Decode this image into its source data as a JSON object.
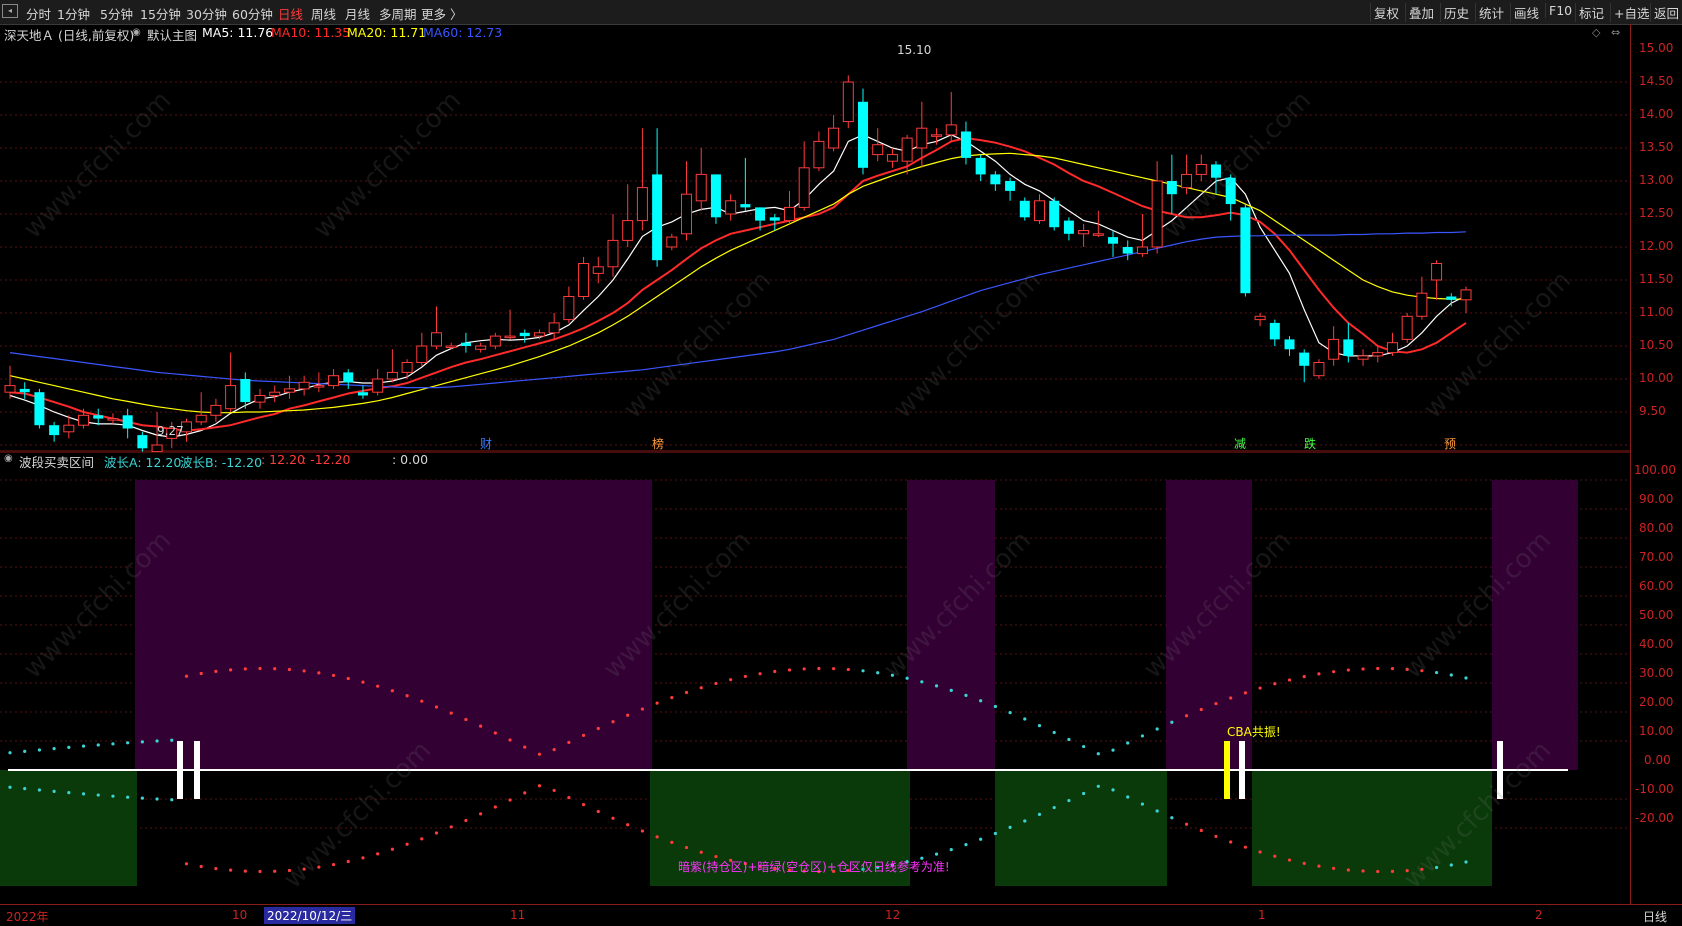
{
  "toolbar": {
    "periods": [
      "分时",
      "1分钟",
      "5分钟",
      "15分钟",
      "30分钟",
      "60分钟",
      "日线",
      "周线",
      "月线",
      "多周期",
      "更多 〉"
    ],
    "active_period": "日线",
    "right_buttons": [
      "复权",
      "叠加",
      "历史",
      "统计",
      "画线",
      "F10",
      "标记",
      "+自选",
      "返回"
    ]
  },
  "main": {
    "title": "深天地Ａ (日线,前复权)",
    "template": "默认主图",
    "ma": [
      {
        "label": "MA5: 11.76",
        "color": "#ffffff"
      },
      {
        "label": "MA10: 11.35",
        "color": "#ff2a2a"
      },
      {
        "label": "MA20: 11.71",
        "color": "#ffff00"
      },
      {
        "label": "MA60: 12.73",
        "color": "#3a56ff"
      }
    ],
    "high_label": "15.10",
    "low_label": "9.27",
    "events": [
      {
        "text": "财",
        "color": "#3a7bff"
      },
      {
        "text": "榜",
        "color": "#ff9a3a"
      },
      {
        "text": "减",
        "color": "#46ff46"
      },
      {
        "text": "跌",
        "color": "#46ff46"
      },
      {
        "text": "预",
        "color": "#ff9a3a"
      }
    ],
    "y_ticks": [
      "15.00",
      "14.50",
      "14.00",
      "13.50",
      "13.00",
      "12.50",
      "12.00",
      "11.50",
      "11.00",
      "10.50",
      "10.00",
      "9.50"
    ]
  },
  "indicator": {
    "title": "波段买卖区间",
    "legend": [
      {
        "label": "波长A: 12.20",
        "color": "#3ad4d4"
      },
      {
        "label": "波长B: -12.20",
        "color": "#3ad4d4"
      },
      {
        "label": ": 12.20",
        "color": "#ff3b3b"
      },
      {
        "label": ": -12.20",
        "color": "#ff3b3b"
      },
      {
        "label": ": 0.00",
        "color": "#d6d6d6"
      }
    ],
    "cba_label": "CBA共振!",
    "note": "暗紫(持仓区)+暗绿(空仓区)+仓区仅日线参考为准!",
    "y_ticks": [
      "100.00",
      "90.00",
      "80.00",
      "70.00",
      "60.00",
      "50.00",
      "40.00",
      "30.00",
      "20.00",
      "10.00",
      "0.00",
      "-10.00",
      "-20.00"
    ]
  },
  "bottom": {
    "dates": [
      "2022年",
      "10",
      "2022/10/12/三",
      "11",
      "12",
      "1",
      "2"
    ],
    "period_label": "日线"
  },
  "watermark": "www.cfchi.com",
  "chart_data": {
    "type": "candlestick",
    "title": "深天地Ａ (日线,前复权)",
    "ylim": [
      9.0,
      15.3
    ],
    "candles": [
      [
        10.3,
        10.4,
        10.7,
        10.2
      ],
      [
        10.35,
        10.3,
        10.45,
        10.2
      ],
      [
        10.3,
        9.8,
        10.35,
        9.75
      ],
      [
        9.8,
        9.65,
        9.85,
        9.55
      ],
      [
        9.7,
        9.8,
        9.95,
        9.6
      ],
      [
        9.8,
        9.95,
        10.05,
        9.75
      ],
      [
        9.95,
        9.9,
        10.05,
        9.8
      ],
      [
        9.9,
        9.9,
        9.98,
        9.82
      ],
      [
        9.95,
        9.75,
        10.05,
        9.6
      ],
      [
        9.65,
        9.45,
        9.7,
        9.4
      ],
      [
        9.4,
        9.5,
        10.0,
        9.27
      ],
      [
        9.6,
        9.75,
        9.85,
        9.45
      ],
      [
        9.7,
        9.85,
        9.9,
        9.55
      ],
      [
        9.85,
        9.95,
        10.3,
        9.8
      ],
      [
        9.95,
        10.1,
        10.2,
        9.85
      ],
      [
        10.05,
        10.4,
        10.9,
        10.0
      ],
      [
        10.5,
        10.15,
        10.6,
        10.05
      ],
      [
        10.15,
        10.25,
        10.35,
        10.05
      ],
      [
        10.25,
        10.3,
        10.4,
        10.15
      ],
      [
        10.3,
        10.35,
        10.55,
        10.2
      ],
      [
        10.35,
        10.45,
        10.55,
        10.25
      ],
      [
        10.4,
        10.4,
        10.6,
        10.3
      ],
      [
        10.4,
        10.55,
        10.65,
        10.35
      ],
      [
        10.6,
        10.45,
        10.65,
        10.35
      ],
      [
        10.3,
        10.25,
        10.4,
        10.2
      ],
      [
        10.3,
        10.5,
        10.65,
        10.25
      ],
      [
        10.5,
        10.6,
        10.95,
        10.45
      ],
      [
        10.6,
        10.75,
        10.8,
        10.5
      ],
      [
        10.75,
        11.0,
        11.2,
        10.7
      ],
      [
        11.0,
        11.2,
        11.6,
        10.95
      ],
      [
        11.0,
        11.0,
        11.05,
        10.95
      ],
      [
        11.05,
        11.0,
        11.2,
        10.9
      ],
      [
        10.95,
        11.0,
        11.05,
        10.9
      ],
      [
        11.0,
        11.15,
        11.2,
        10.95
      ],
      [
        11.15,
        11.15,
        11.55,
        11.1
      ],
      [
        11.2,
        11.15,
        11.25,
        11.05
      ],
      [
        11.15,
        11.2,
        11.25,
        11.1
      ],
      [
        11.2,
        11.35,
        11.5,
        11.1
      ],
      [
        11.4,
        11.75,
        11.9,
        11.35
      ],
      [
        11.75,
        12.25,
        12.35,
        11.7
      ],
      [
        12.1,
        12.2,
        12.35,
        11.95
      ],
      [
        12.2,
        12.6,
        13.0,
        12.05
      ],
      [
        12.6,
        12.9,
        13.45,
        12.5
      ],
      [
        12.9,
        13.4,
        14.3,
        12.75
      ],
      [
        13.6,
        12.3,
        14.3,
        12.2
      ],
      [
        12.5,
        12.65,
        12.7,
        12.45
      ],
      [
        12.7,
        13.3,
        13.8,
        12.6
      ],
      [
        13.2,
        13.6,
        14.0,
        13.05
      ],
      [
        13.6,
        12.95,
        13.6,
        12.85
      ],
      [
        13.0,
        13.2,
        13.3,
        12.9
      ],
      [
        13.15,
        13.1,
        13.85,
        13.05
      ],
      [
        13.1,
        12.9,
        13.1,
        12.75
      ],
      [
        12.95,
        12.9,
        13.0,
        12.75
      ],
      [
        12.9,
        13.1,
        13.35,
        12.85
      ],
      [
        13.1,
        13.7,
        14.1,
        13.05
      ],
      [
        13.7,
        14.1,
        14.25,
        13.65
      ],
      [
        14.0,
        14.3,
        14.5,
        13.95
      ],
      [
        14.4,
        15.0,
        15.1,
        14.3
      ],
      [
        14.7,
        13.7,
        14.9,
        13.6
      ],
      [
        13.9,
        14.05,
        14.3,
        13.8
      ],
      [
        13.8,
        13.9,
        14.0,
        13.7
      ],
      [
        13.8,
        14.15,
        14.2,
        13.6
      ],
      [
        14.0,
        14.3,
        14.7,
        13.7
      ],
      [
        14.2,
        14.2,
        14.3,
        14.05
      ],
      [
        14.2,
        14.35,
        14.85,
        14.1
      ],
      [
        14.25,
        13.85,
        14.4,
        13.75
      ],
      [
        13.85,
        13.6,
        13.9,
        13.5
      ],
      [
        13.6,
        13.45,
        13.65,
        13.35
      ],
      [
        13.5,
        13.35,
        13.55,
        13.2
      ],
      [
        13.2,
        12.95,
        13.25,
        12.9
      ],
      [
        12.9,
        13.2,
        13.3,
        12.85
      ],
      [
        13.2,
        12.8,
        13.25,
        12.75
      ],
      [
        12.9,
        12.7,
        12.95,
        12.6
      ],
      [
        12.7,
        12.75,
        12.85,
        12.5
      ],
      [
        12.7,
        12.7,
        13.05,
        12.65
      ],
      [
        12.65,
        12.55,
        12.75,
        12.35
      ],
      [
        12.5,
        12.4,
        12.6,
        12.3
      ],
      [
        12.4,
        12.5,
        13.0,
        12.35
      ],
      [
        12.5,
        13.5,
        13.8,
        12.4
      ],
      [
        13.5,
        13.3,
        13.9,
        13.0
      ],
      [
        13.4,
        13.6,
        13.9,
        13.3
      ],
      [
        13.6,
        13.75,
        13.9,
        13.5
      ],
      [
        13.75,
        13.55,
        13.8,
        13.3
      ],
      [
        13.55,
        13.15,
        13.6,
        12.9
      ],
      [
        13.1,
        11.8,
        13.15,
        11.75
      ],
      [
        11.4,
        11.45,
        11.5,
        11.3
      ],
      [
        11.35,
        11.1,
        11.4,
        11.0
      ],
      [
        11.1,
        10.95,
        11.15,
        10.85
      ],
      [
        10.9,
        10.7,
        10.95,
        10.45
      ],
      [
        10.55,
        10.75,
        10.8,
        10.5
      ],
      [
        10.8,
        11.1,
        11.3,
        10.7
      ],
      [
        11.1,
        10.85,
        11.35,
        10.75
      ],
      [
        10.8,
        10.85,
        10.95,
        10.7
      ],
      [
        10.85,
        10.9,
        11.0,
        10.75
      ],
      [
        10.9,
        11.05,
        11.2,
        10.85
      ],
      [
        11.1,
        11.45,
        11.5,
        11.05
      ],
      [
        11.45,
        11.8,
        12.05,
        11.4
      ],
      [
        12.0,
        12.25,
        12.3,
        11.7
      ],
      [
        11.75,
        11.7,
        11.8,
        11.6
      ],
      [
        11.7,
        11.85,
        11.9,
        11.5
      ]
    ],
    "series": [
      {
        "name": "MA5",
        "color": "#ffffff",
        "values": [
          10.25,
          10.18,
          10.1,
          10.0,
          9.92,
          9.85,
          9.82,
          9.82,
          9.8,
          9.72,
          9.65,
          9.62,
          9.66,
          9.72,
          9.82,
          9.98,
          10.1,
          10.2,
          10.23,
          10.3,
          10.35,
          10.42,
          10.45,
          10.46,
          10.44,
          10.44,
          10.47,
          10.53,
          10.68,
          10.86,
          10.96,
          11.05,
          11.08,
          11.1,
          11.09,
          11.1,
          11.13,
          11.2,
          11.32,
          11.54,
          11.75,
          12.0,
          12.32,
          12.66,
          12.8,
          12.88,
          13.0,
          13.07,
          13.1,
          13.0,
          13.04,
          13.08,
          13.1,
          13.05,
          13.22,
          13.45,
          13.65,
          14.1,
          14.2,
          14.1,
          14.0,
          13.95,
          14.05,
          14.1,
          14.2,
          14.1,
          13.95,
          13.8,
          13.6,
          13.45,
          13.35,
          13.2,
          13.05,
          12.9,
          12.85,
          12.75,
          12.65,
          12.6,
          12.75,
          12.9,
          13.1,
          13.3,
          13.5,
          13.55,
          13.3,
          12.8,
          12.45,
          12.1,
          11.55,
          11.05,
          10.9,
          10.85,
          10.85,
          10.85,
          10.9,
          11.0,
          11.2,
          11.45,
          11.65,
          11.76
        ]
      },
      {
        "name": "MA10",
        "color": "#ff2a2a",
        "values": [
          10.3,
          10.28,
          10.22,
          10.15,
          10.08,
          10.0,
          9.95,
          9.9,
          9.85,
          9.8,
          9.78,
          9.74,
          9.72,
          9.74,
          9.77,
          9.8,
          9.86,
          9.92,
          9.97,
          10.05,
          10.1,
          10.16,
          10.22,
          10.28,
          10.32,
          10.36,
          10.39,
          10.44,
          10.52,
          10.6,
          10.68,
          10.75,
          10.8,
          10.86,
          10.92,
          10.98,
          11.04,
          11.1,
          11.18,
          11.27,
          11.38,
          11.5,
          11.65,
          11.85,
          12.0,
          12.15,
          12.32,
          12.48,
          12.6,
          12.7,
          12.75,
          12.8,
          12.85,
          12.9,
          12.95,
          13.0,
          13.1,
          13.3,
          13.5,
          13.58,
          13.65,
          13.72,
          13.85,
          13.97,
          14.1,
          14.15,
          14.12,
          14.08,
          14.02,
          13.95,
          13.85,
          13.75,
          13.62,
          13.5,
          13.42,
          13.32,
          13.22,
          13.12,
          13.05,
          13.0,
          12.95,
          12.95,
          12.98,
          13.02,
          12.98,
          12.88,
          12.7,
          12.45,
          12.15,
          11.85,
          11.58,
          11.35,
          11.18,
          11.0,
          10.92,
          10.9,
          10.95,
          11.05,
          11.2,
          11.35
        ]
      },
      {
        "name": "MA20",
        "color": "#ffff00",
        "values": [
          10.55,
          10.5,
          10.45,
          10.4,
          10.35,
          10.3,
          10.25,
          10.2,
          10.16,
          10.12,
          10.08,
          10.05,
          10.02,
          10.0,
          9.99,
          9.99,
          10.0,
          10.0,
          10.01,
          10.02,
          10.03,
          10.05,
          10.07,
          10.1,
          10.13,
          10.17,
          10.22,
          10.28,
          10.34,
          10.4,
          10.46,
          10.52,
          10.58,
          10.64,
          10.7,
          10.77,
          10.84,
          10.92,
          11.0,
          11.1,
          11.2,
          11.32,
          11.45,
          11.6,
          11.75,
          11.9,
          12.05,
          12.2,
          12.33,
          12.45,
          12.55,
          12.65,
          12.75,
          12.85,
          12.95,
          13.05,
          13.15,
          13.3,
          13.42,
          13.5,
          13.58,
          13.65,
          13.72,
          13.78,
          13.84,
          13.88,
          13.9,
          13.91,
          13.92,
          13.9,
          13.88,
          13.85,
          13.8,
          13.75,
          13.7,
          13.65,
          13.6,
          13.55,
          13.5,
          13.45,
          13.4,
          13.35,
          13.3,
          13.25,
          13.15,
          13.05,
          12.9,
          12.75,
          12.6,
          12.45,
          12.3,
          12.15,
          12.0,
          11.9,
          11.82,
          11.77,
          11.74,
          11.72,
          11.71,
          11.71
        ]
      },
      {
        "name": "MA60",
        "color": "#3a56ff",
        "values": [
          10.9,
          10.87,
          10.84,
          10.81,
          10.78,
          10.75,
          10.72,
          10.69,
          10.66,
          10.63,
          10.6,
          10.58,
          10.56,
          10.54,
          10.52,
          10.5,
          10.48,
          10.47,
          10.46,
          10.45,
          10.44,
          10.43,
          10.42,
          10.41,
          10.4,
          10.39,
          10.38,
          10.37,
          10.37,
          10.37,
          10.38,
          10.4,
          10.42,
          10.44,
          10.46,
          10.48,
          10.5,
          10.52,
          10.54,
          10.56,
          10.58,
          10.6,
          10.62,
          10.64,
          10.67,
          10.7,
          10.73,
          10.76,
          10.79,
          10.82,
          10.85,
          10.88,
          10.91,
          10.95,
          11.0,
          11.05,
          11.1,
          11.17,
          11.24,
          11.31,
          11.38,
          11.45,
          11.52,
          11.6,
          11.68,
          11.76,
          11.84,
          11.9,
          11.96,
          12.02,
          12.08,
          12.13,
          12.18,
          12.23,
          12.28,
          12.33,
          12.38,
          12.43,
          12.48,
          12.53,
          12.58,
          12.62,
          12.65,
          12.66,
          12.67,
          12.67,
          12.68,
          12.68,
          12.68,
          12.68,
          12.68,
          12.69,
          12.69,
          12.7,
          12.7,
          12.71,
          12.71,
          12.72,
          12.72,
          12.73
        ]
      }
    ]
  }
}
